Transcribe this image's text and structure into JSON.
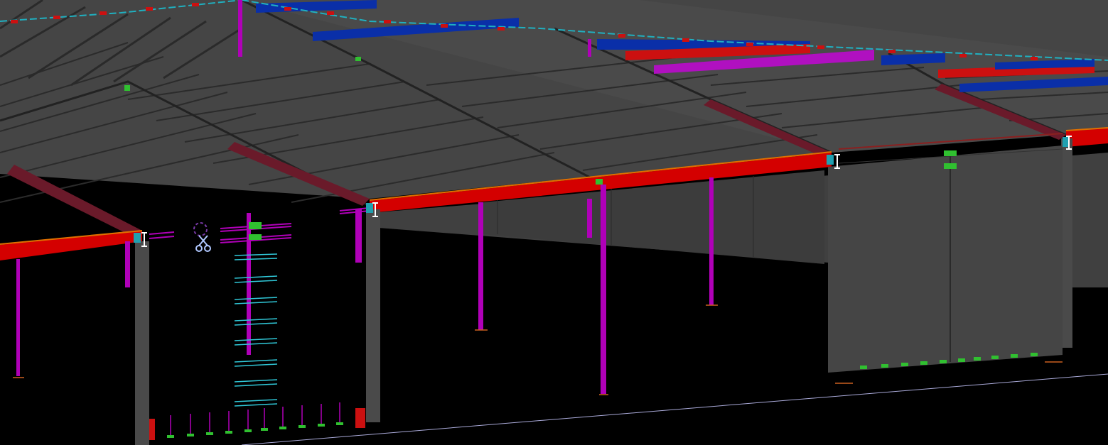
{
  "viewport": {
    "background": "#000000",
    "cursor_tool": "scissors-cursor-icon"
  },
  "colors": {
    "roof_panel": "#484848",
    "roof_panel_dark": "#3a3a3a",
    "joist": "#2a2a2a",
    "girder_red": "#d40000",
    "girder_edge": "#e07000",
    "column_magenta": "#b000b8",
    "column_gray": "#4a4a4a",
    "wall_gray": "#454545",
    "duct_blue": "#0a2fa8",
    "duct_red": "#cc1010",
    "duct_magenta": "#b010c0",
    "pipe_cyan": "#20b0c0",
    "rebar_cyan": "#30c8d8",
    "connector_green": "#30c030",
    "grid_line": "#c8c8ff",
    "dimension_white": "#ffffff"
  }
}
